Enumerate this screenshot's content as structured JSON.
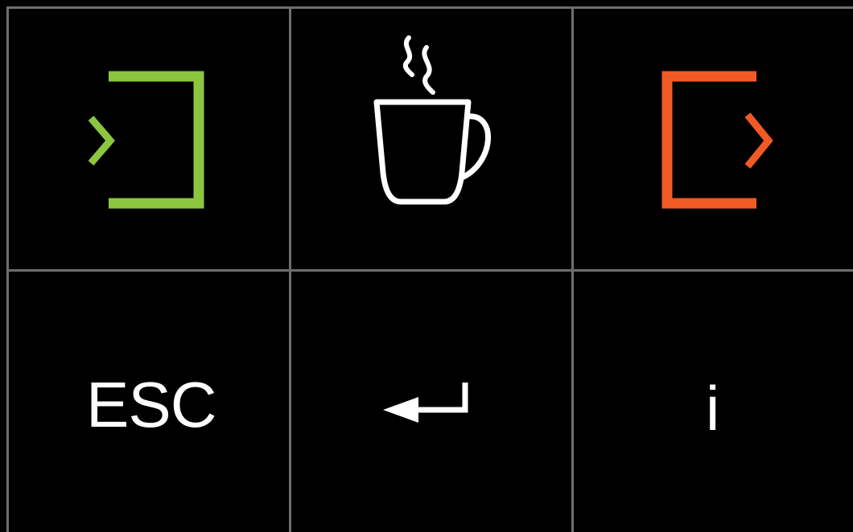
{
  "keypad": {
    "keys": [
      {
        "id": "check-in",
        "icon": "check-in-icon",
        "color": "#8cc63f"
      },
      {
        "id": "break",
        "icon": "coffee-cup-icon",
        "color": "#ffffff"
      },
      {
        "id": "check-out",
        "icon": "check-out-icon",
        "color": "#f15a24"
      },
      {
        "id": "escape",
        "label": "ESC",
        "color": "#ffffff"
      },
      {
        "id": "enter",
        "icon": "enter-arrow-icon",
        "color": "#ffffff"
      },
      {
        "id": "info",
        "label": "i",
        "color": "#ffffff"
      }
    ]
  },
  "colors": {
    "background": "#000000",
    "grid_line": "#6e6e6e",
    "check_in_accent": "#8cc63f",
    "check_out_accent": "#f15a24"
  }
}
